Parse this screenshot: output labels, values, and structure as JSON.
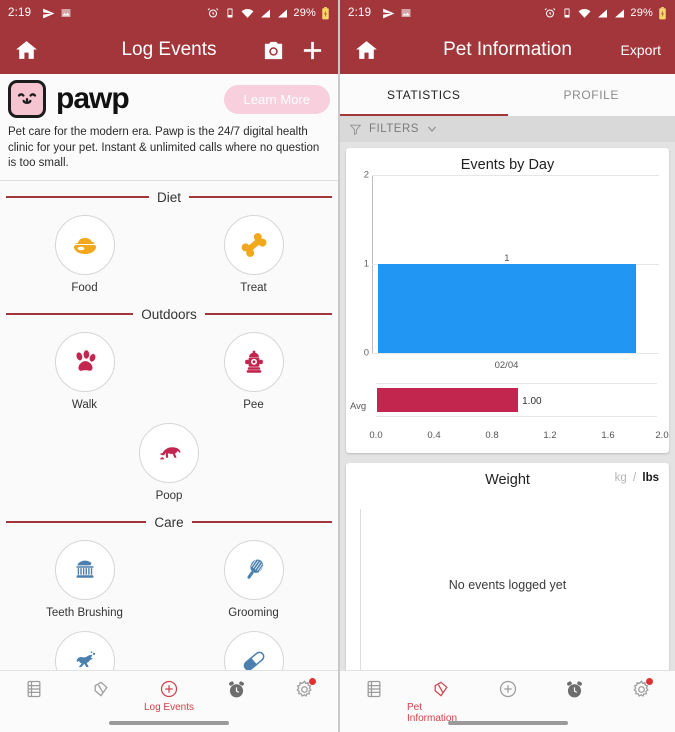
{
  "status_bar": {
    "time": "2:19",
    "battery_percent": "29%",
    "icons": [
      "send-icon",
      "image-icon",
      "alarm-icon",
      "vibrate-icon",
      "wifi-icon",
      "signal-icon",
      "signal-icon",
      "battery-charging-icon"
    ]
  },
  "left": {
    "appbar": {
      "title": "Log Events",
      "home_icon": "home-icon",
      "camera_icon": "camera-icon",
      "add_icon": "plus-icon"
    },
    "banner": {
      "brand": "pawp",
      "logo_icon": "pawp-cat-face-logo",
      "cta_label": "Learn More",
      "description": "Pet care for the modern era. Pawp is the 24/7 digital health clinic for your pet. Instant & unlimited calls where no question is too small."
    },
    "sections": [
      {
        "title": "Diet",
        "color": "#f2a81d",
        "items": [
          {
            "label": "Food",
            "icon": "food-bowl-icon"
          },
          {
            "label": "Treat",
            "icon": "bone-icon"
          }
        ]
      },
      {
        "title": "Outdoors",
        "color": "#c2254e",
        "items": [
          {
            "label": "Walk",
            "icon": "paw-print-icon"
          },
          {
            "label": "Pee",
            "icon": "fire-hydrant-icon"
          },
          {
            "label": "Poop",
            "icon": "pooping-dog-icon"
          }
        ]
      },
      {
        "title": "Care",
        "color": "#4a7fae",
        "items": [
          {
            "label": "Teeth Brushing",
            "icon": "toothbrush-icon"
          },
          {
            "label": "Grooming",
            "icon": "hair-brush-icon"
          },
          {
            "label": "",
            "icon": "jumping-dog-icon"
          },
          {
            "label": "",
            "icon": "pill-capsule-icon"
          }
        ]
      }
    ],
    "bottom_nav": [
      {
        "label": "",
        "icon": "journal-icon",
        "active": false
      },
      {
        "label": "",
        "icon": "pet-tag-icon",
        "active": false
      },
      {
        "label": "Log Events",
        "icon": "plus-circle-icon",
        "active": true
      },
      {
        "label": "",
        "icon": "alarm-clock-icon",
        "active": false
      },
      {
        "label": "",
        "icon": "gear-icon",
        "active": false,
        "badge": true
      }
    ]
  },
  "right": {
    "appbar": {
      "title": "Pet Information",
      "home_icon": "home-icon",
      "export_label": "Export"
    },
    "tabs": [
      {
        "label": "STATISTICS",
        "active": true
      },
      {
        "label": "PROFILE",
        "active": false
      }
    ],
    "filters": {
      "label": "FILTERS",
      "icon": "funnel-icon",
      "chevron": "chevron-down-icon"
    },
    "weight_card": {
      "title": "Weight",
      "unit_kg": "kg",
      "unit_sep": "/",
      "unit_lbs": "lbs",
      "active_unit": "lbs",
      "empty_message": "No events logged yet"
    },
    "bottom_nav": [
      {
        "label": "",
        "icon": "journal-icon",
        "active": false
      },
      {
        "label": "Pet Information",
        "icon": "pet-tag-icon",
        "active": true
      },
      {
        "label": "",
        "icon": "plus-circle-icon",
        "active": false
      },
      {
        "label": "",
        "icon": "alarm-clock-icon",
        "active": false
      },
      {
        "label": "",
        "icon": "gear-icon",
        "active": false,
        "badge": true
      }
    ]
  },
  "chart_data": [
    {
      "type": "bar",
      "title": "Events by Day",
      "categories": [
        "02/04"
      ],
      "values": [
        1
      ],
      "data_labels": [
        "1"
      ],
      "xlabel": "",
      "ylabel": "",
      "ylim": [
        0,
        2
      ],
      "yticks": [
        "0",
        "1",
        "2"
      ],
      "grid": true,
      "bar_color": "#2196f3",
      "legend": "none"
    },
    {
      "type": "bar",
      "orientation": "horizontal",
      "title": "",
      "categories": [
        "Avg"
      ],
      "values": [
        1.0
      ],
      "data_labels": [
        "1.00"
      ],
      "xlim": [
        0.0,
        2.0
      ],
      "xticks": [
        "0.0",
        "0.4",
        "0.8",
        "1.2",
        "1.6",
        "2.0"
      ],
      "grid": true,
      "bar_color": "#c2254e",
      "legend": "none"
    }
  ]
}
